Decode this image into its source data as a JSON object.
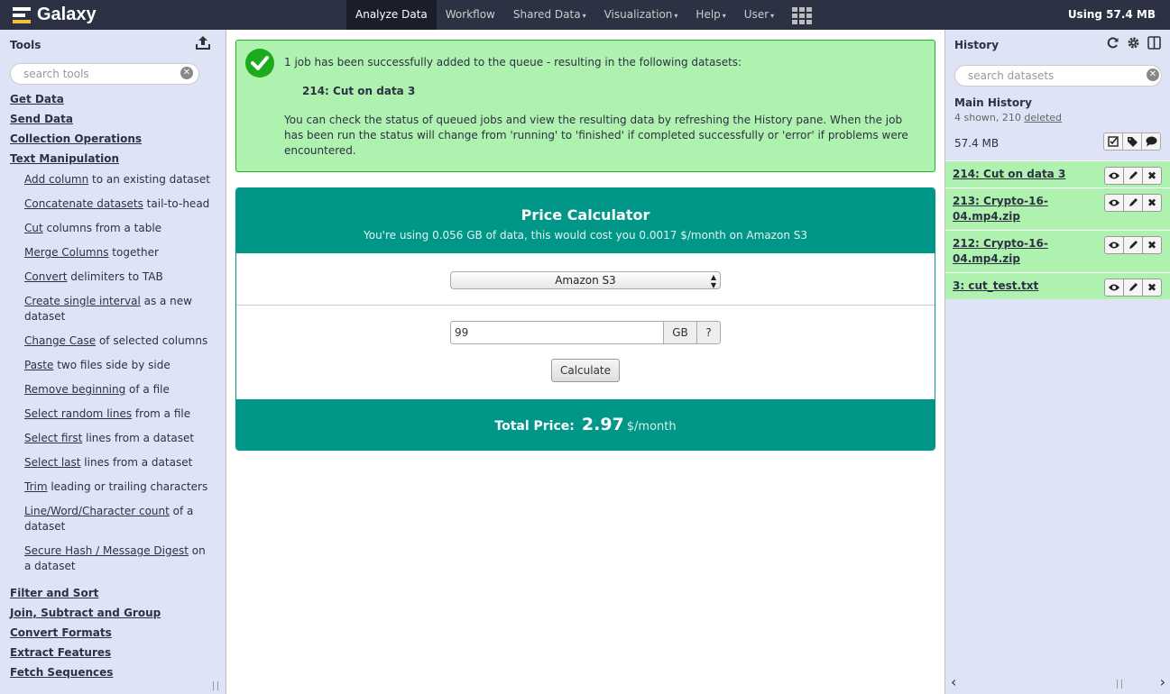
{
  "masthead": {
    "brand": "Galaxy",
    "nav": [
      {
        "label": "Analyze Data",
        "caret": false,
        "active": true
      },
      {
        "label": "Workflow",
        "caret": false,
        "active": false
      },
      {
        "label": "Shared Data",
        "caret": true,
        "active": false
      },
      {
        "label": "Visualization",
        "caret": true,
        "active": false
      },
      {
        "label": "Help",
        "caret": true,
        "active": false
      },
      {
        "label": "User",
        "caret": true,
        "active": false
      }
    ],
    "quota": "Using 57.4 MB"
  },
  "tools_panel": {
    "title": "Tools",
    "search_placeholder": "search tools",
    "sections_top": [
      "Get Data",
      "Send Data",
      "Collection Operations",
      "Text Manipulation"
    ],
    "text_tools": [
      {
        "link": "Add column",
        "rest": " to an existing dataset"
      },
      {
        "link": "Concatenate datasets",
        "rest": " tail-to-head"
      },
      {
        "link": "Cut",
        "rest": " columns from a table"
      },
      {
        "link": "Merge Columns",
        "rest": " together"
      },
      {
        "link": "Convert",
        "rest": " delimiters to TAB"
      },
      {
        "link": "Create single interval",
        "rest": " as a new dataset"
      },
      {
        "link": "Change Case",
        "rest": " of selected columns"
      },
      {
        "link": "Paste",
        "rest": " two files side by side"
      },
      {
        "link": "Remove beginning",
        "rest": " of a file"
      },
      {
        "link": "Select random lines",
        "rest": " from a file"
      },
      {
        "link": "Select first",
        "rest": " lines from a dataset"
      },
      {
        "link": "Select last",
        "rest": " lines from a dataset"
      },
      {
        "link": "Trim",
        "rest": " leading or trailing characters"
      },
      {
        "link": "Line/Word/Character count",
        "rest": " of a dataset"
      },
      {
        "link": "Secure Hash / Message Digest",
        "rest": " on a dataset"
      }
    ],
    "sections_bottom": [
      "Filter and Sort",
      "Join, Subtract and Group",
      "Convert Formats",
      "Extract Features",
      "Fetch Sequences"
    ]
  },
  "message": {
    "line1": "1 job has been successfully added to the queue - resulting in the following datasets:",
    "dataset": "214: Cut on data 3",
    "body": "You can check the status of queued jobs and view the resulting data by refreshing the History pane. When the job has been run the status will change from 'running' to 'finished' if completed successfully or 'error' if problems were encountered."
  },
  "calculator": {
    "title": "Price Calculator",
    "subtitle": "You're using 0.056 GB of data, this would cost you 0.0017 $/month on Amazon S3",
    "provider": "Amazon S3",
    "amount": "99",
    "unit_label": "GB",
    "help_label": "?",
    "button": "Calculate",
    "total_label": "Total Price:",
    "total_value": "2.97",
    "total_unit": "$/month"
  },
  "history": {
    "title": "History",
    "search_placeholder": "search datasets",
    "name": "Main History",
    "count_prefix": "4 shown, 210 ",
    "deleted_link": "deleted",
    "size": "57.4 MB",
    "datasets": [
      {
        "title": "214: Cut on data 3"
      },
      {
        "title": "213: Crypto-16-04.mp4.zip"
      },
      {
        "title": "212: Crypto-16-04.mp4.zip"
      },
      {
        "title": "3: cut_test.txt"
      }
    ]
  },
  "colors": {
    "masthead": "#2c3143",
    "panel": "#dee4f5",
    "ok_green": "#aff1af",
    "calc_teal": "#009688"
  }
}
